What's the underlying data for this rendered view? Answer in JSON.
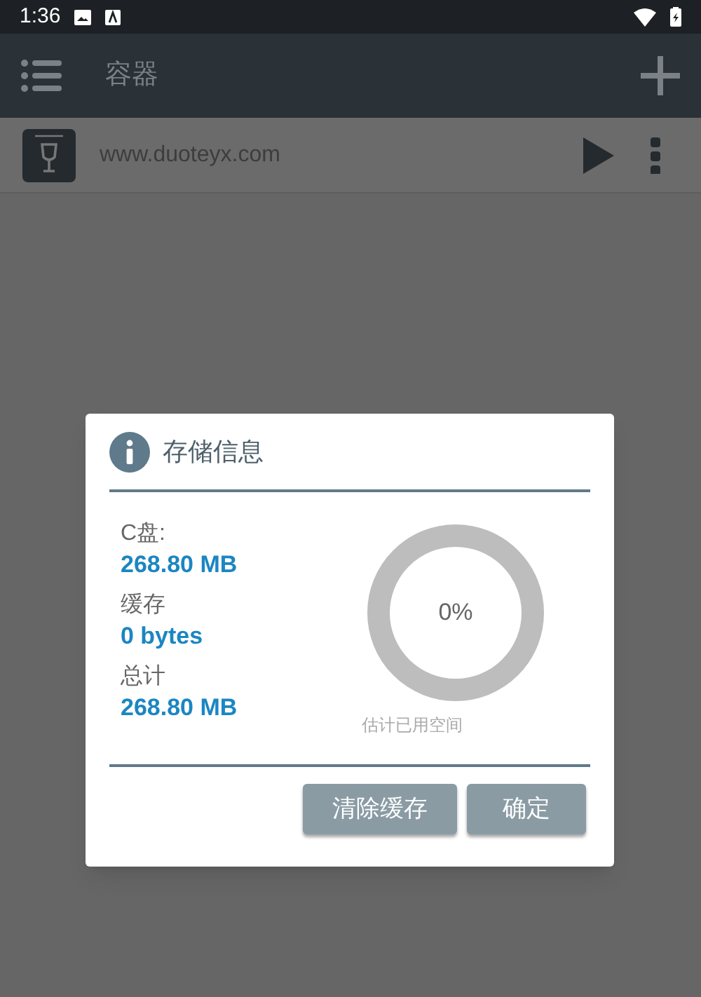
{
  "status_bar": {
    "time": "1:36"
  },
  "app_bar": {
    "title": "容器"
  },
  "containers": [
    {
      "name": "www.duoteyx.com"
    }
  ],
  "dialog": {
    "title": "存储信息",
    "stats": [
      {
        "label": "C盘:",
        "value": "268.80 MB"
      },
      {
        "label": "缓存",
        "value": "0 bytes"
      },
      {
        "label": "总计",
        "value": "268.80 MB"
      }
    ],
    "gauge": {
      "reading": "0%",
      "caption": "估计已用空间"
    },
    "buttons": [
      "清除缓存",
      "确定"
    ]
  }
}
